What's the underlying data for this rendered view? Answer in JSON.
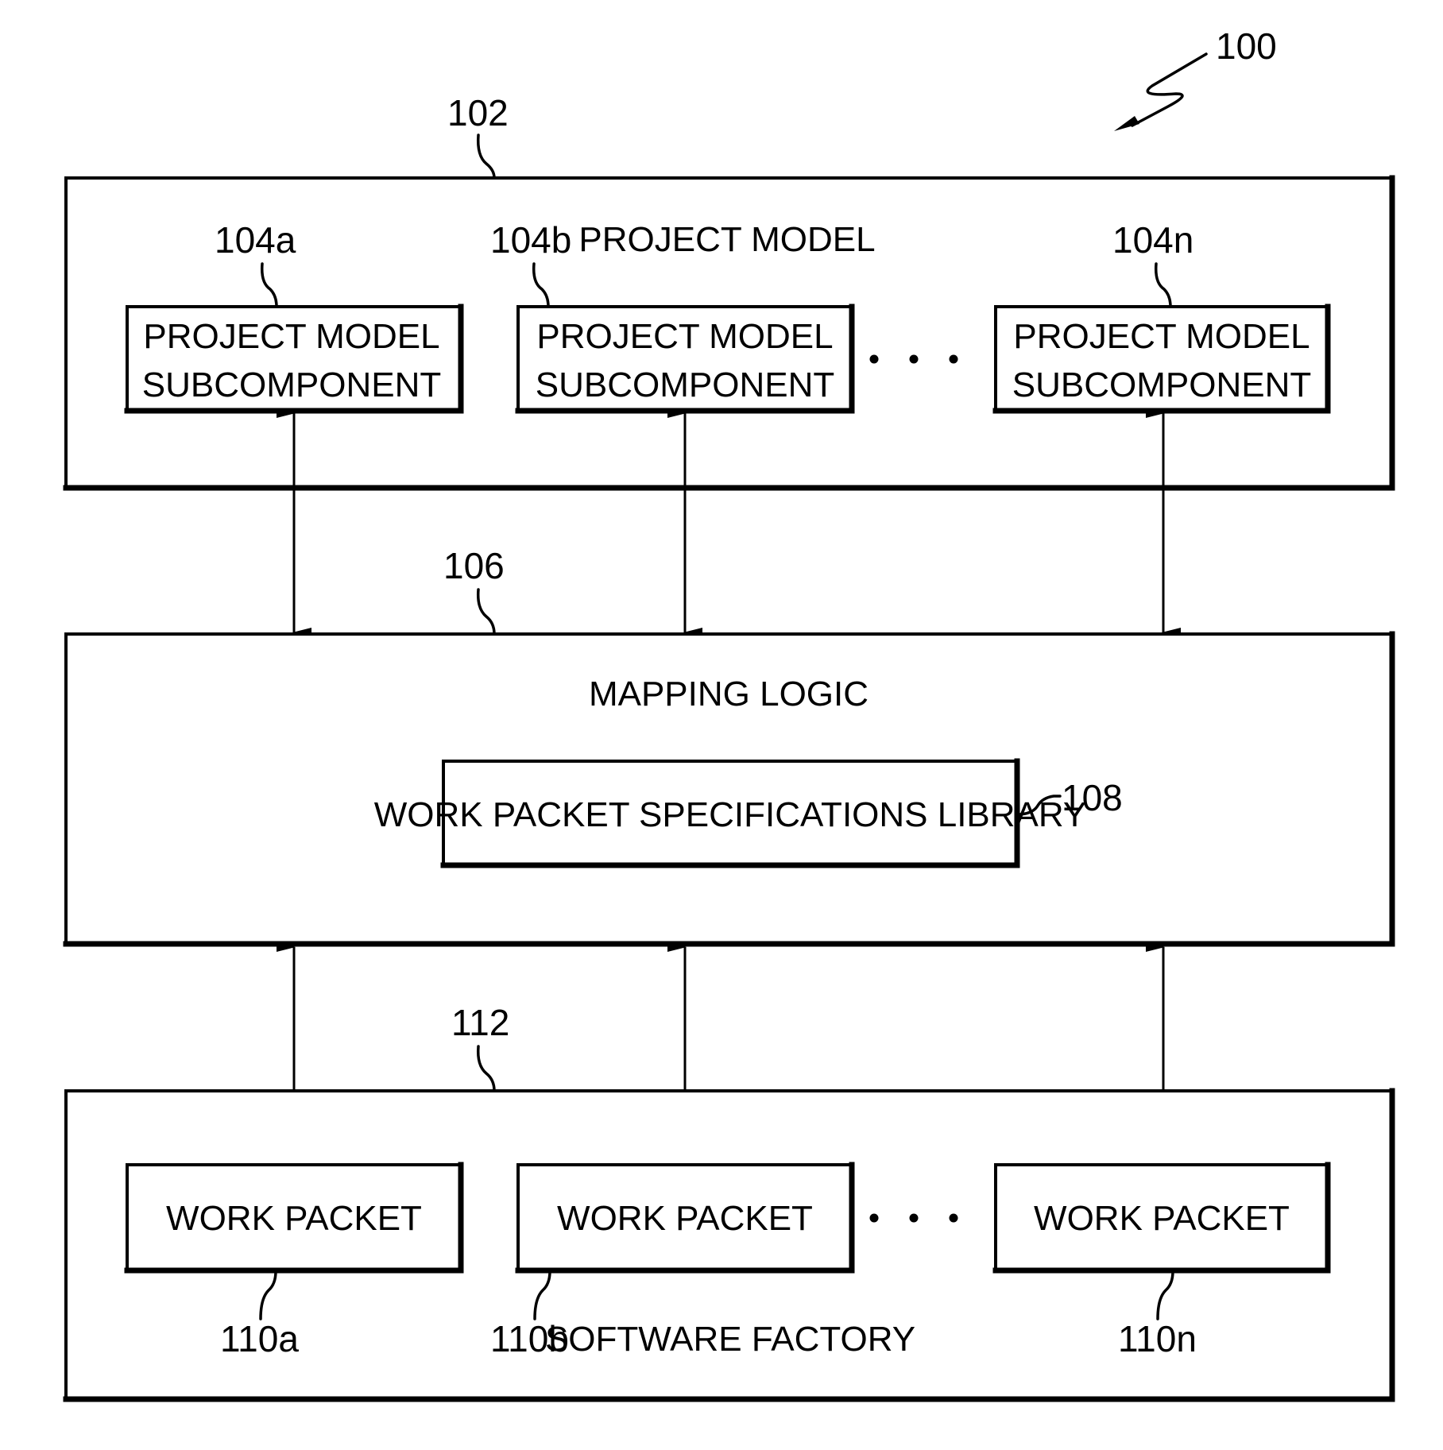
{
  "figure_ref": "100",
  "project_model": {
    "ref": "102",
    "title": "PROJECT MODEL",
    "subcomponents": [
      {
        "ref": "104a",
        "line1": "PROJECT MODEL",
        "line2": "SUBCOMPONENT"
      },
      {
        "ref": "104b",
        "line1": "PROJECT MODEL",
        "line2": "SUBCOMPONENT"
      },
      {
        "ref": "104n",
        "line1": "PROJECT MODEL",
        "line2": "SUBCOMPONENT"
      }
    ],
    "ellipsis": "• • •"
  },
  "mapping_logic": {
    "ref": "106",
    "title": "MAPPING LOGIC",
    "library": {
      "ref": "108",
      "label": "WORK PACKET SPECIFICATIONS LIBRARY"
    }
  },
  "software_factory": {
    "ref": "112",
    "title": "SOFTWARE FACTORY",
    "work_packets": [
      {
        "ref": "110a",
        "label": "WORK PACKET"
      },
      {
        "ref": "110b",
        "label": "WORK PACKET"
      },
      {
        "ref": "110n",
        "label": "WORK PACKET"
      }
    ],
    "ellipsis": "• • •"
  },
  "connections": [
    {
      "from": "104a",
      "to": "106",
      "direction": "bidirectional"
    },
    {
      "from": "104b",
      "to": "106",
      "direction": "bidirectional"
    },
    {
      "from": "104n",
      "to": "106",
      "direction": "bidirectional"
    },
    {
      "from": "106",
      "to": "110a",
      "direction": "bidirectional"
    },
    {
      "from": "106",
      "to": "110b",
      "direction": "bidirectional"
    },
    {
      "from": "106",
      "to": "110n",
      "direction": "bidirectional"
    }
  ]
}
